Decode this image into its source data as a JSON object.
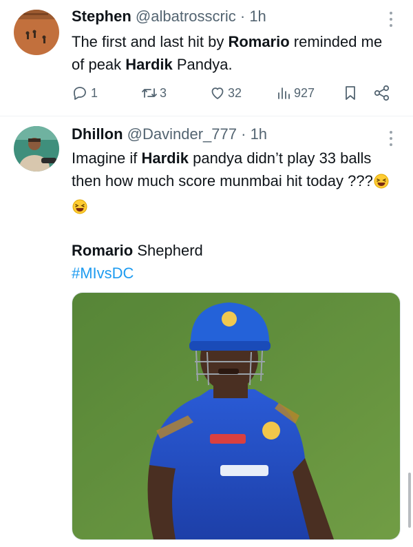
{
  "tweet1": {
    "display_name": "Stephen",
    "handle": "@albatrosscric",
    "sep": " · ",
    "time": "1h",
    "text_parts": [
      "The first and last hit by ",
      "Romario",
      " reminded me of peak ",
      "Hardik",
      " Pandya."
    ],
    "stats": {
      "replies": "1",
      "retweets": "3",
      "likes": "32",
      "views": "927"
    }
  },
  "tweet2": {
    "display_name": "Dhillon",
    "handle": "@Davinder_777",
    "sep": " · ",
    "time": "1h",
    "text_parts": [
      "Imagine if ",
      "Hardik",
      " pandya didn’t play 33 balls then how much score munmbai hit today ???"
    ],
    "caption_bold": "Romario",
    "caption_rest": " Shepherd",
    "hashtag": "#MIvsDC"
  },
  "icons": {
    "reply": "reply-icon",
    "retweet": "retweet-icon",
    "like": "heart-icon",
    "views": "views-icon",
    "bookmark": "bookmark-icon",
    "share": "share-icon",
    "more": "more-icon"
  },
  "colors": {
    "accent": "#1d9bf0",
    "muted": "#536471",
    "text": "#0f1419"
  }
}
